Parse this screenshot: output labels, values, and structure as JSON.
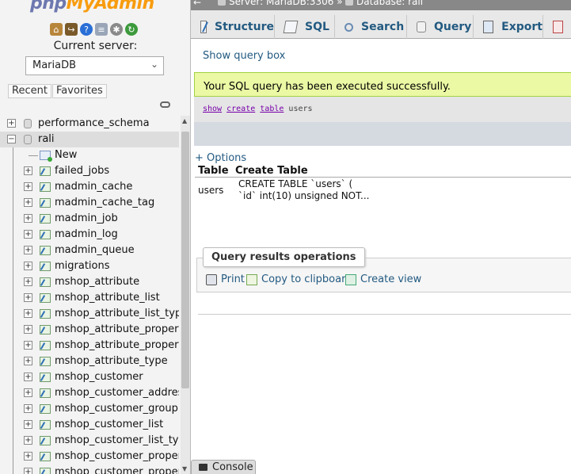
{
  "nav": {
    "logo_php": "php",
    "logo_myadmin": "MyAdmin",
    "icons": [
      "home-icon",
      "exit-icon",
      "help-icon",
      "docs-icon",
      "settings-icon",
      "reload-icon"
    ],
    "current_server_label": "Current server:",
    "server_value": "MariaDB",
    "recent_label": "Recent",
    "favorites_label": "Favorites",
    "tree": [
      {
        "label": "performance_schema",
        "type": "db"
      },
      {
        "label": "rali",
        "type": "db-open"
      },
      {
        "label": "New",
        "type": "new"
      },
      {
        "label": "failed_jobs",
        "type": "table"
      },
      {
        "label": "madmin_cache",
        "type": "table"
      },
      {
        "label": "madmin_cache_tag",
        "type": "table"
      },
      {
        "label": "madmin_job",
        "type": "table"
      },
      {
        "label": "madmin_log",
        "type": "table"
      },
      {
        "label": "madmin_queue",
        "type": "table"
      },
      {
        "label": "migrations",
        "type": "table"
      },
      {
        "label": "mshop_attribute",
        "type": "table"
      },
      {
        "label": "mshop_attribute_list",
        "type": "table"
      },
      {
        "label": "mshop_attribute_list_type",
        "type": "table"
      },
      {
        "label": "mshop_attribute_property",
        "type": "table"
      },
      {
        "label": "mshop_attribute_property_t",
        "type": "table"
      },
      {
        "label": "mshop_attribute_type",
        "type": "table"
      },
      {
        "label": "mshop_customer",
        "type": "table"
      },
      {
        "label": "mshop_customer_address",
        "type": "table"
      },
      {
        "label": "mshop_customer_group",
        "type": "table"
      },
      {
        "label": "mshop_customer_list",
        "type": "table"
      },
      {
        "label": "mshop_customer_list_type",
        "type": "table"
      },
      {
        "label": "mshop_customer_property",
        "type": "table"
      },
      {
        "label": "mshop_customer_property",
        "type": "table"
      }
    ]
  },
  "breadcrumb": {
    "server": "Server: MariaDB:3306 »",
    "database": "Database: rali"
  },
  "tabs": [
    {
      "label": "Structure",
      "icon": "structure-icon"
    },
    {
      "label": "SQL",
      "icon": "sql-icon"
    },
    {
      "label": "Search",
      "icon": "search-icon"
    },
    {
      "label": "Query",
      "icon": "query-icon"
    },
    {
      "label": "Export",
      "icon": "export-icon"
    },
    {
      "label": "",
      "icon": "import-icon"
    }
  ],
  "main": {
    "show_query_box": "Show query box",
    "success_message": "Your SQL query has been executed successfully.",
    "sql_keywords": [
      "show",
      "create",
      "table"
    ],
    "sql_rest": "users",
    "options_link": "+ Options",
    "table_headers": [
      "Table",
      "Create Table"
    ],
    "row": {
      "table": "users",
      "create_line1": "CREATE TABLE `users` (",
      "create_line2": " `id` int(10) unsigned NOT..."
    },
    "qro_legend": "Query results operations",
    "print_label": "Print",
    "copy_label": "Copy to clipboard",
    "create_view_label": "Create view"
  },
  "console_label": "Console",
  "colors": {
    "link": "#235a81",
    "success_bg": "#ebf8a4",
    "logo_php": "#6c78af",
    "logo_admin": "#f89c0e"
  }
}
